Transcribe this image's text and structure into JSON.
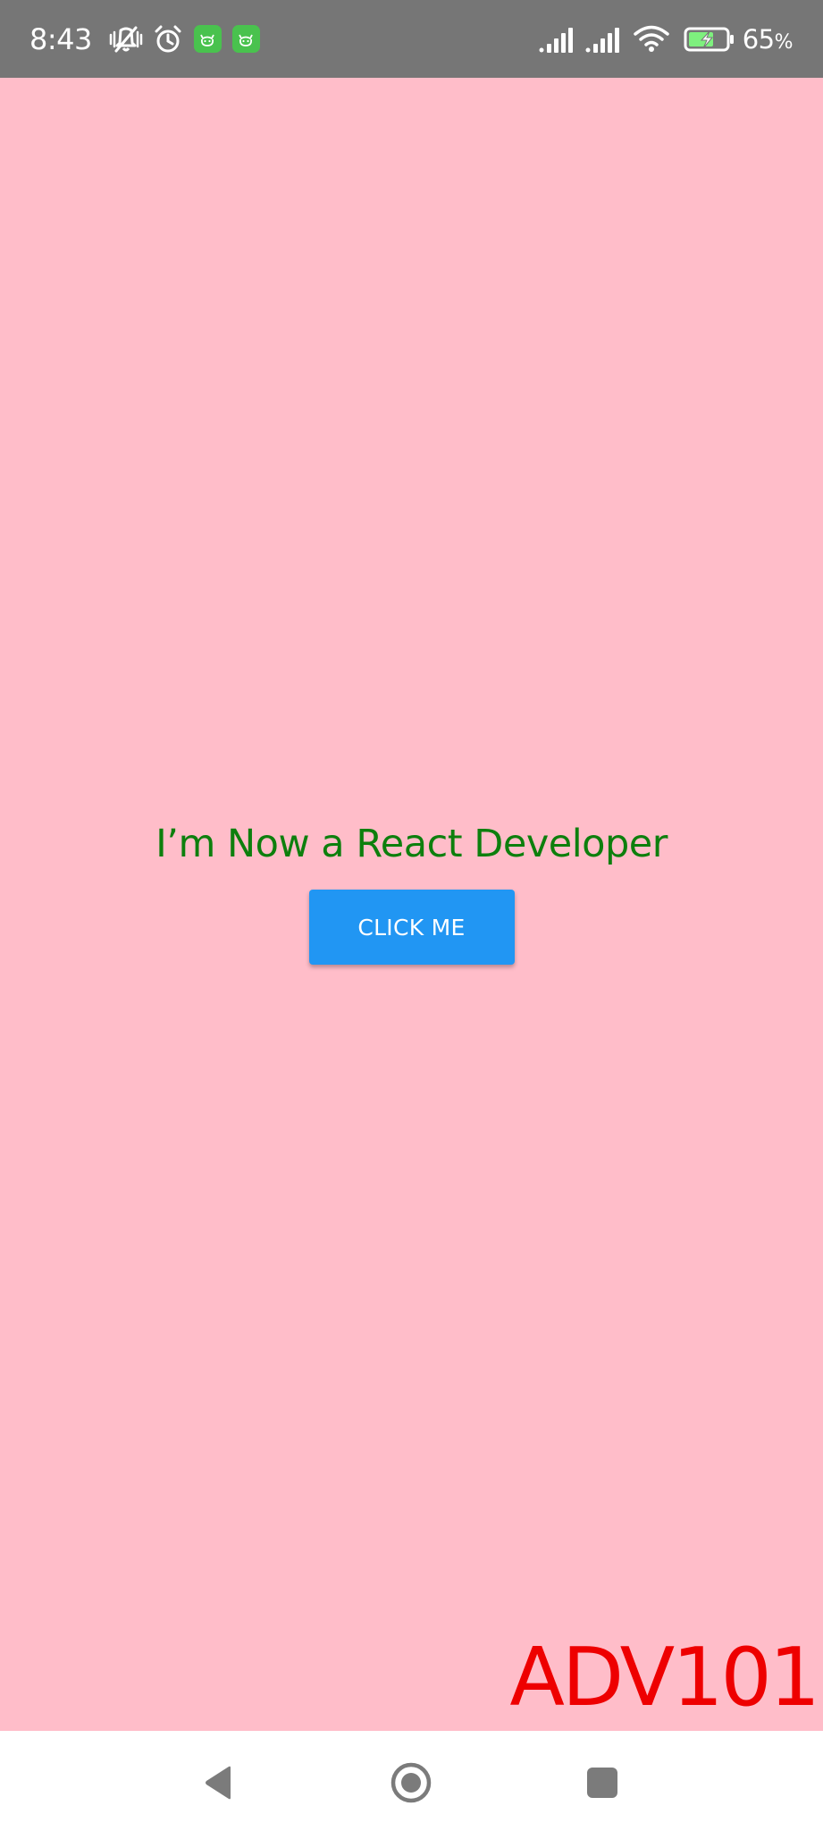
{
  "status_bar": {
    "time": "8:43",
    "icons": [
      "silent-vibrate-icon",
      "alarm-clock-icon",
      "app-notification-icon",
      "app-notification-icon",
      "signal-strength-icon",
      "signal-strength-icon",
      "wifi-icon",
      "battery-charging-icon"
    ],
    "battery_value": "65",
    "battery_unit": "%",
    "app_icon_color": "#49c24e"
  },
  "app": {
    "background_color": "#ffbdc9",
    "headline": "I’m Now a React Developer",
    "headline_color": "#0d7f0d",
    "button_label": "CLICK ME",
    "button_color": "#2196f3",
    "watermark": "ADV101",
    "watermark_color": "#ee0000"
  },
  "nav_bar": {
    "icons": [
      "back-triangle-icon",
      "home-circle-icon",
      "recents-square-icon"
    ]
  }
}
